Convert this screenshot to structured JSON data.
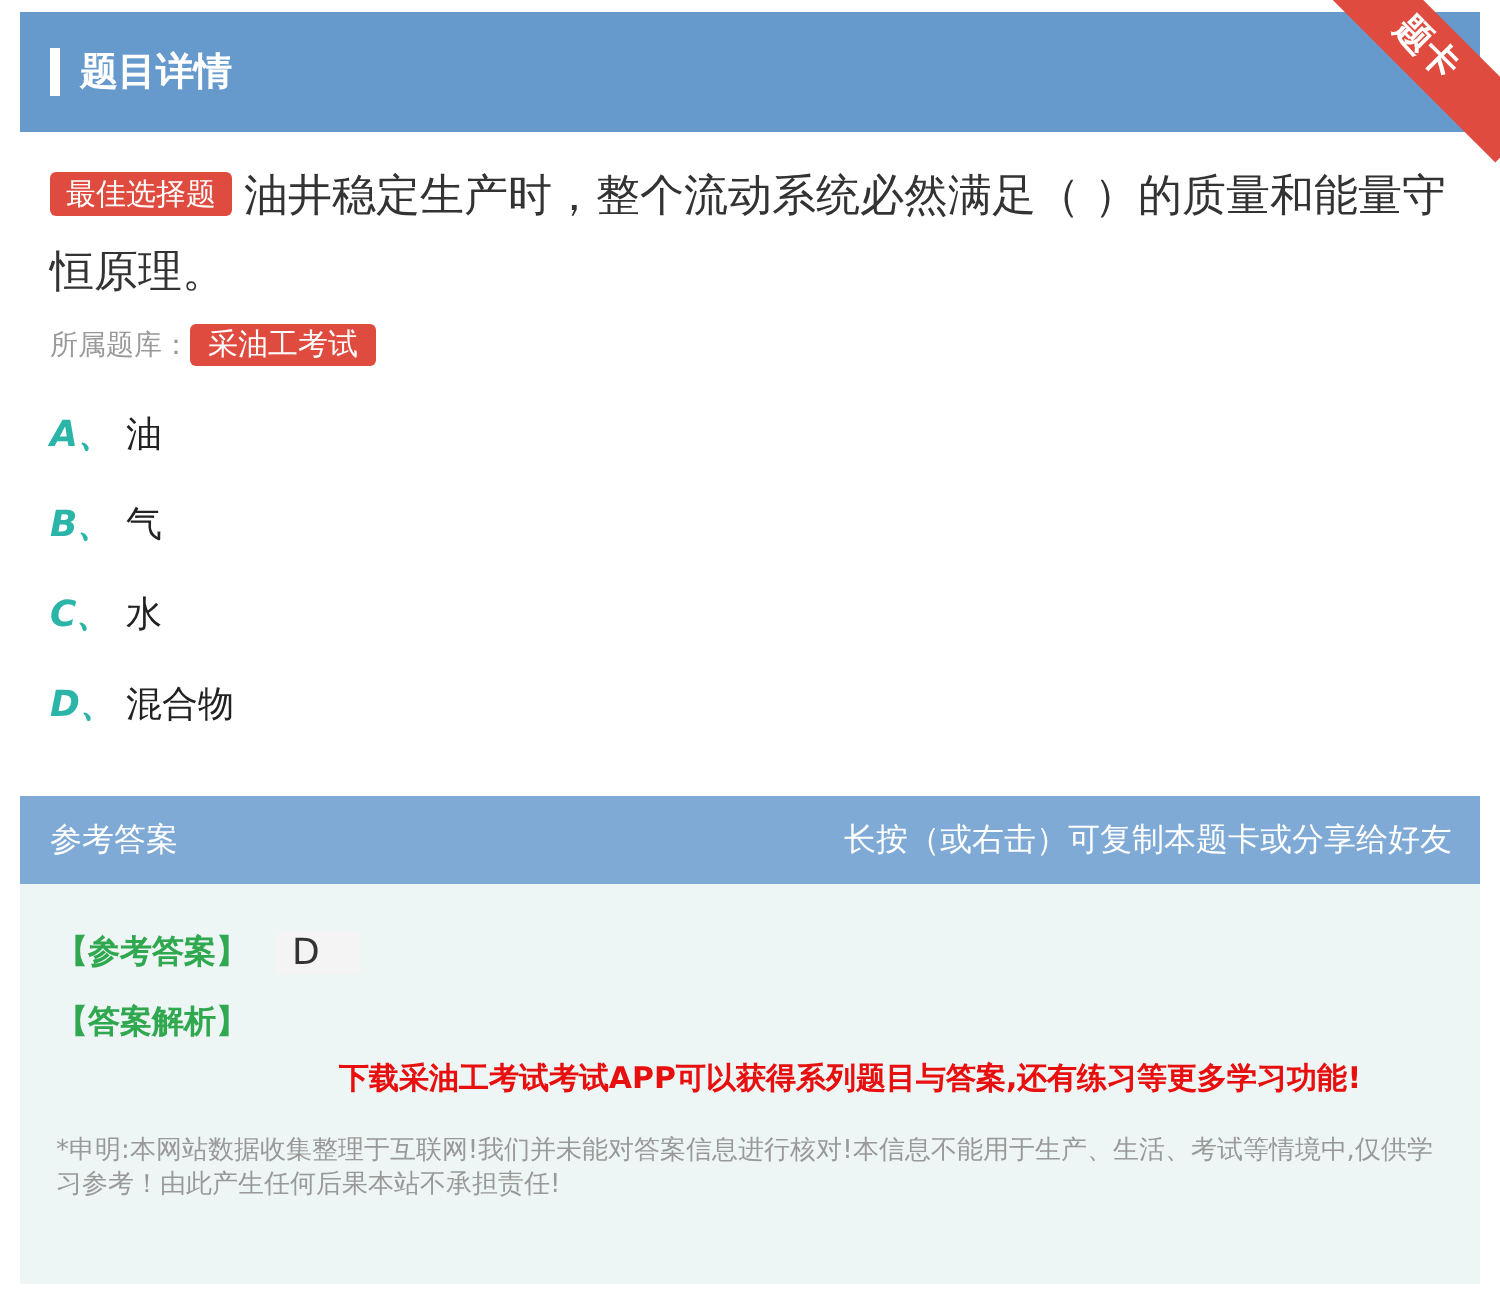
{
  "header": {
    "title": "题目详情",
    "ribbon": "题卡"
  },
  "question": {
    "type_badge": "最佳选择题",
    "text": "油井稳定生产时，整个流动系统必然满足（ ）的质量和能量守恒原理。",
    "bank_label": "所属题库：",
    "bank": "采油工考试"
  },
  "options": [
    {
      "letter": "A、",
      "text": "油"
    },
    {
      "letter": "B、",
      "text": "气"
    },
    {
      "letter": "C、",
      "text": "水"
    },
    {
      "letter": "D、",
      "text": "混合物"
    }
  ],
  "answer_bar": {
    "title": "参考答案",
    "hint": "长按（或右击）可复制本题卡或分享给好友"
  },
  "answer": {
    "label": "【参考答案】",
    "value": "D",
    "analysis_label": "【答案解析】",
    "promo": "下载采油工考试考试APP可以获得系列题目与答案,还有练习等更多学习功能!",
    "disclaimer": "*申明:本网站数据收集整理于互联网!我们并未能对答案信息进行核对!本信息不能用于生产、生活、考试等情境中,仅供学习参考！由此产生任何后果本站不承担责任!"
  }
}
